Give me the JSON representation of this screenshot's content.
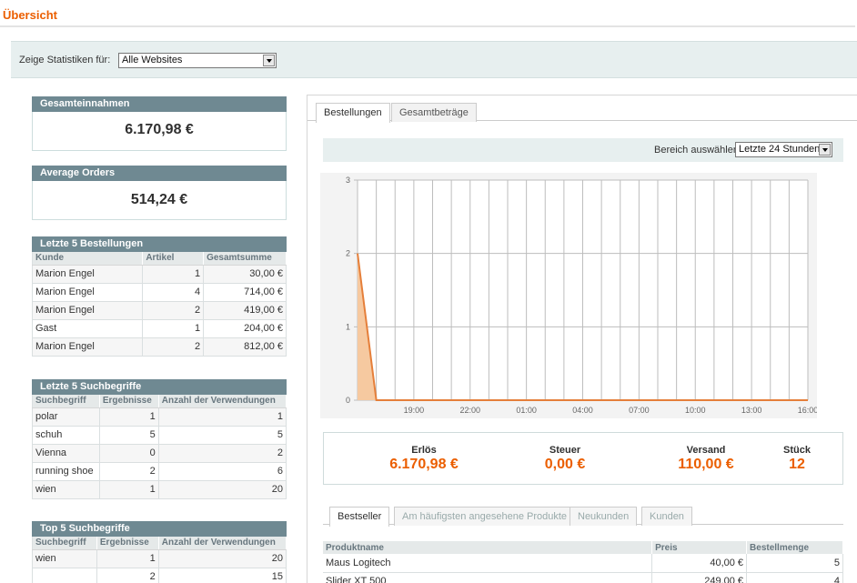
{
  "page": {
    "title": "Übersicht"
  },
  "store_switcher": {
    "label": "Zeige Statistiken für:",
    "value": "Alle Websites"
  },
  "lifetime_sales": {
    "title": "Gesamteinnahmen",
    "value": "6.170,98 €"
  },
  "average_orders": {
    "title": "Average Orders",
    "value": "514,24 €"
  },
  "last_orders": {
    "title": "Letzte 5 Bestellungen",
    "columns": [
      "Kunde",
      "Artikel",
      "Gesamtsumme"
    ],
    "rows": [
      [
        "Marion Engel",
        "1",
        "30,00 €"
      ],
      [
        "Marion Engel",
        "4",
        "714,00 €"
      ],
      [
        "Marion Engel",
        "2",
        "419,00 €"
      ],
      [
        "Gast",
        "1",
        "204,00 €"
      ],
      [
        "Marion Engel",
        "2",
        "812,00 €"
      ]
    ]
  },
  "last_searches": {
    "title": "Letzte 5 Suchbegriffe",
    "columns": [
      "Suchbegriff",
      "Ergebnisse",
      "Anzahl der Verwendungen"
    ],
    "rows": [
      [
        "polar",
        "1",
        "1"
      ],
      [
        "schuh",
        "5",
        "5"
      ],
      [
        "Vienna",
        "0",
        "2"
      ],
      [
        "running shoe",
        "2",
        "6"
      ],
      [
        "wien",
        "1",
        "20"
      ]
    ]
  },
  "top_searches": {
    "title": "Top 5 Suchbegriffe",
    "columns": [
      "Suchbegriff",
      "Ergebnisse",
      "Anzahl der Verwendungen"
    ],
    "rows": [
      [
        "wien",
        "1",
        "20"
      ],
      [
        "",
        "2",
        "15"
      ]
    ]
  },
  "chart_tabs": [
    {
      "label": "Bestellungen",
      "active": true
    },
    {
      "label": "Gesamtbeträge",
      "active": false
    }
  ],
  "range": {
    "label": "Bereich auswählen:",
    "value": "Letzte 24 Stunden"
  },
  "chart_data": {
    "type": "area",
    "x": [
      "16:00",
      "17:00",
      "18:00",
      "19:00",
      "20:00",
      "21:00",
      "22:00",
      "23:00",
      "00:00",
      "01:00",
      "02:00",
      "03:00",
      "04:00",
      "05:00",
      "06:00",
      "07:00",
      "08:00",
      "09:00",
      "10:00",
      "11:00",
      "12:00",
      "13:00",
      "14:00",
      "15:00",
      "16:00"
    ],
    "x_tick_labels": [
      "19:00",
      "22:00",
      "01:00",
      "04:00",
      "07:00",
      "10:00",
      "13:00",
      "16:00"
    ],
    "series": [
      {
        "values": [
          2,
          0,
          0,
          0,
          0,
          0,
          0,
          0,
          0,
          0,
          0,
          0,
          0,
          0,
          0,
          0,
          0,
          0,
          0,
          0,
          0,
          0,
          0,
          0,
          0
        ]
      }
    ],
    "ylim": [
      0,
      3
    ],
    "y_ticks": [
      0,
      1,
      2,
      3
    ],
    "grid": true,
    "color": "#e57f3a",
    "fill": "#f6c9a0"
  },
  "totals": [
    {
      "label": "Erlös",
      "value": "6.170,98 €"
    },
    {
      "label": "Steuer",
      "value": "0,00 €"
    },
    {
      "label": "Versand",
      "value": "110,00 €"
    },
    {
      "label": "Stück",
      "value": "12"
    }
  ],
  "grid_tabs": [
    {
      "label": "Bestseller",
      "active": true
    },
    {
      "label": "Am häufigsten angesehene Produkte",
      "active": false
    },
    {
      "label": "Neukunden",
      "active": false
    },
    {
      "label": "Kunden",
      "active": false
    }
  ],
  "bestsellers": {
    "columns": [
      "Produktname",
      "Preis",
      "Bestellmenge"
    ],
    "rows": [
      [
        "Maus Logitech",
        "40,00 €",
        "5"
      ],
      [
        "Slider XT 500",
        "249,00 €",
        "4"
      ]
    ]
  },
  "colors": {
    "accent": "#eb5e00",
    "box_header": "#6f8992",
    "panel_bg": "#e7efef"
  }
}
